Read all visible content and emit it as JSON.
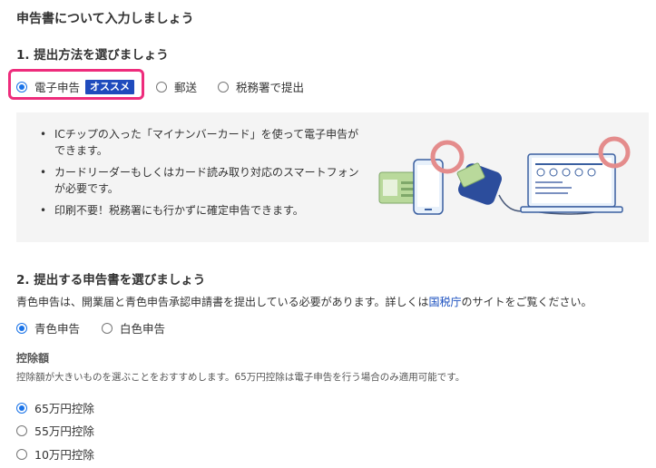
{
  "page_title": "申告書について入力しましょう",
  "section1": {
    "title": "1. 提出方法を選びましょう",
    "options": [
      {
        "label": "電子申告",
        "checked": true,
        "badge": "オススメ"
      },
      {
        "label": "郵送",
        "checked": false
      },
      {
        "label": "税務署で提出",
        "checked": false
      }
    ],
    "bullets": [
      "ICチップの入った「マイナンバーカード」を使って電子申告ができます。",
      "カードリーダーもしくはカード読み取り対応のスマートフォンが必要です。",
      "印刷不要！税務署にも行かずに確定申告できます。"
    ]
  },
  "section2": {
    "title": "2. 提出する申告書を選びましょう",
    "description_prefix": "青色申告は、開業届と青色申告承認申請書を提出している必要があります。詳しくは",
    "description_link": "国税庁",
    "description_suffix": "のサイトをご覧ください。",
    "options": [
      {
        "label": "青色申告",
        "checked": true
      },
      {
        "label": "白色申告",
        "checked": false
      }
    ],
    "deduction": {
      "heading": "控除額",
      "note": "控除額が大きいものを選ぶことをおすすめします。65万円控除は電子申告を行う場合のみ適用可能です。",
      "options": [
        {
          "label": "65万円控除",
          "checked": true
        },
        {
          "label": "55万円控除",
          "checked": false
        },
        {
          "label": "10万円控除",
          "checked": false
        }
      ]
    }
  },
  "colors": {
    "accent": "#1a73e8",
    "highlight_border": "#ee2c7c",
    "badge_bg": "#1f4bbd",
    "panel_bg": "#f4f4f4",
    "link": "#1a4fbf"
  }
}
